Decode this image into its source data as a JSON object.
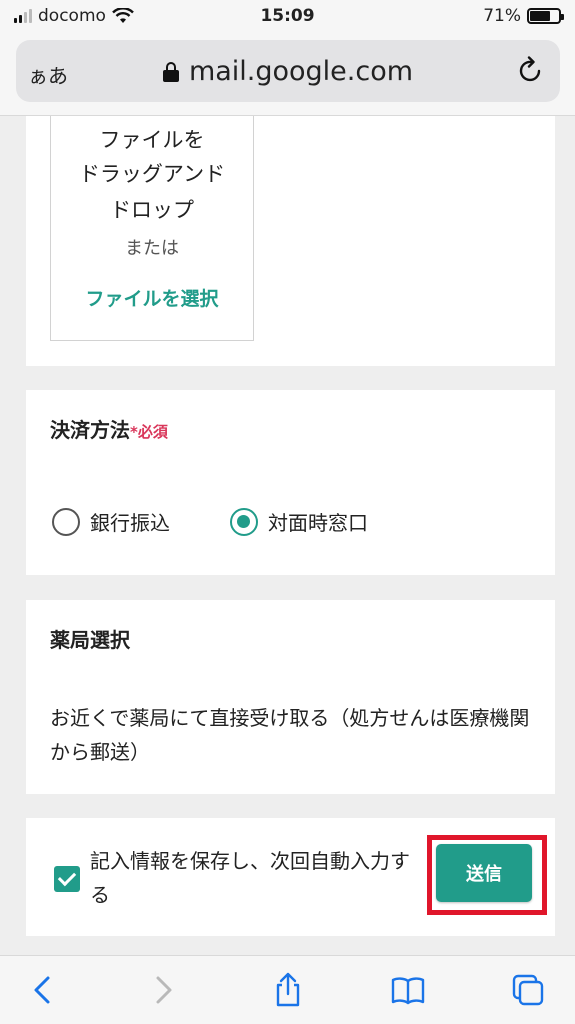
{
  "status_bar": {
    "carrier": "docomo",
    "time": "15:09",
    "battery": "71%",
    "battery_level": 0.71
  },
  "address_bar": {
    "text_size_label": "ぁあ",
    "url": "mail.google.com",
    "lock_icon": "lock-icon",
    "reload_icon": "reload-icon"
  },
  "file_upload": {
    "line1": "ファイルを",
    "line2": "ドラッグアンド",
    "line3": "ドロップ",
    "or_text": "または",
    "select_link": "ファイルを選択"
  },
  "payment": {
    "title": "決済方法",
    "required": "*必須",
    "options": [
      {
        "label": "銀行振込",
        "selected": false
      },
      {
        "label": "対面時窓口",
        "selected": true
      }
    ]
  },
  "pharmacy": {
    "title": "薬局選択",
    "description": "お近くで薬局にて直接受け取る（処方せんは医療機関から郵送）"
  },
  "footer_form": {
    "save_label": "記入情報を保存し、次回自動入力する",
    "save_checked": true,
    "send_label": "送信"
  },
  "toolbar": {
    "icons": [
      "back-icon",
      "forward-icon",
      "share-icon",
      "bookmarks-icon",
      "tabs-icon"
    ]
  },
  "colors": {
    "accent": "#219c8a",
    "required": "#d9365a",
    "highlight": "#e0162b"
  }
}
